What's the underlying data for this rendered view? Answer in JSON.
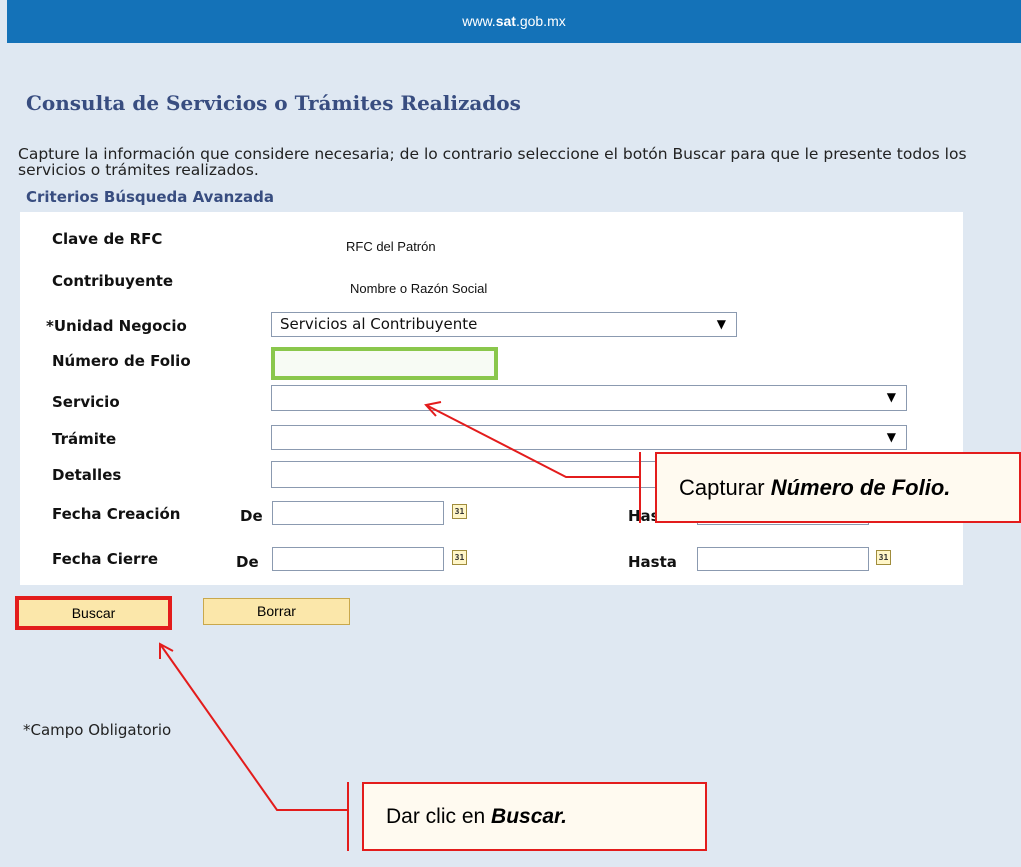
{
  "banner": {
    "prefix": "www.",
    "brand": "sat",
    "suffix": ".gob.mx"
  },
  "page": {
    "title": "Consulta de Servicios o Trámites Realizados",
    "instructions": "Capture la información que considere necesaria; de lo contrario seleccione el botón Buscar para que le presente todos los servicios o trámites realizados.",
    "section_title": "Criterios Búsqueda Avanzada"
  },
  "form": {
    "rfc_label": "Clave de RFC",
    "rfc_value": "RFC del Patrón",
    "contribuyente_label": "Contribuyente",
    "contribuyente_value": "Nombre o Razón Social",
    "unidad_label": "*Unidad Negocio",
    "unidad_value": "Servicios al Contribuyente",
    "folio_label": "Número de Folio",
    "folio_value": "",
    "servicio_label": "Servicio",
    "servicio_value": "",
    "tramite_label": "Trámite",
    "tramite_value": "",
    "detalles_label": "Detalles",
    "detalles_value": "",
    "fecha_creacion_label": "Fecha Creación",
    "fecha_cierre_label": "Fecha Cierre",
    "de_label": "De",
    "hasta_label": "Hasta",
    "calendar_glyph": "31"
  },
  "buttons": {
    "buscar": "Buscar",
    "borrar": "Borrar"
  },
  "footnote": "*Campo Obligatorio",
  "callouts": {
    "folio_prefix": "Capturar ",
    "folio_emph": "Número de Folio.",
    "buscar_prefix": "Dar clic en ",
    "buscar_emph": "Buscar."
  },
  "colors": {
    "banner": "#1472b8",
    "title": "#384d80",
    "folio_highlight": "#8ac74c",
    "annotation_red": "#e31c1c",
    "button_fill": "#fbe7aa"
  }
}
